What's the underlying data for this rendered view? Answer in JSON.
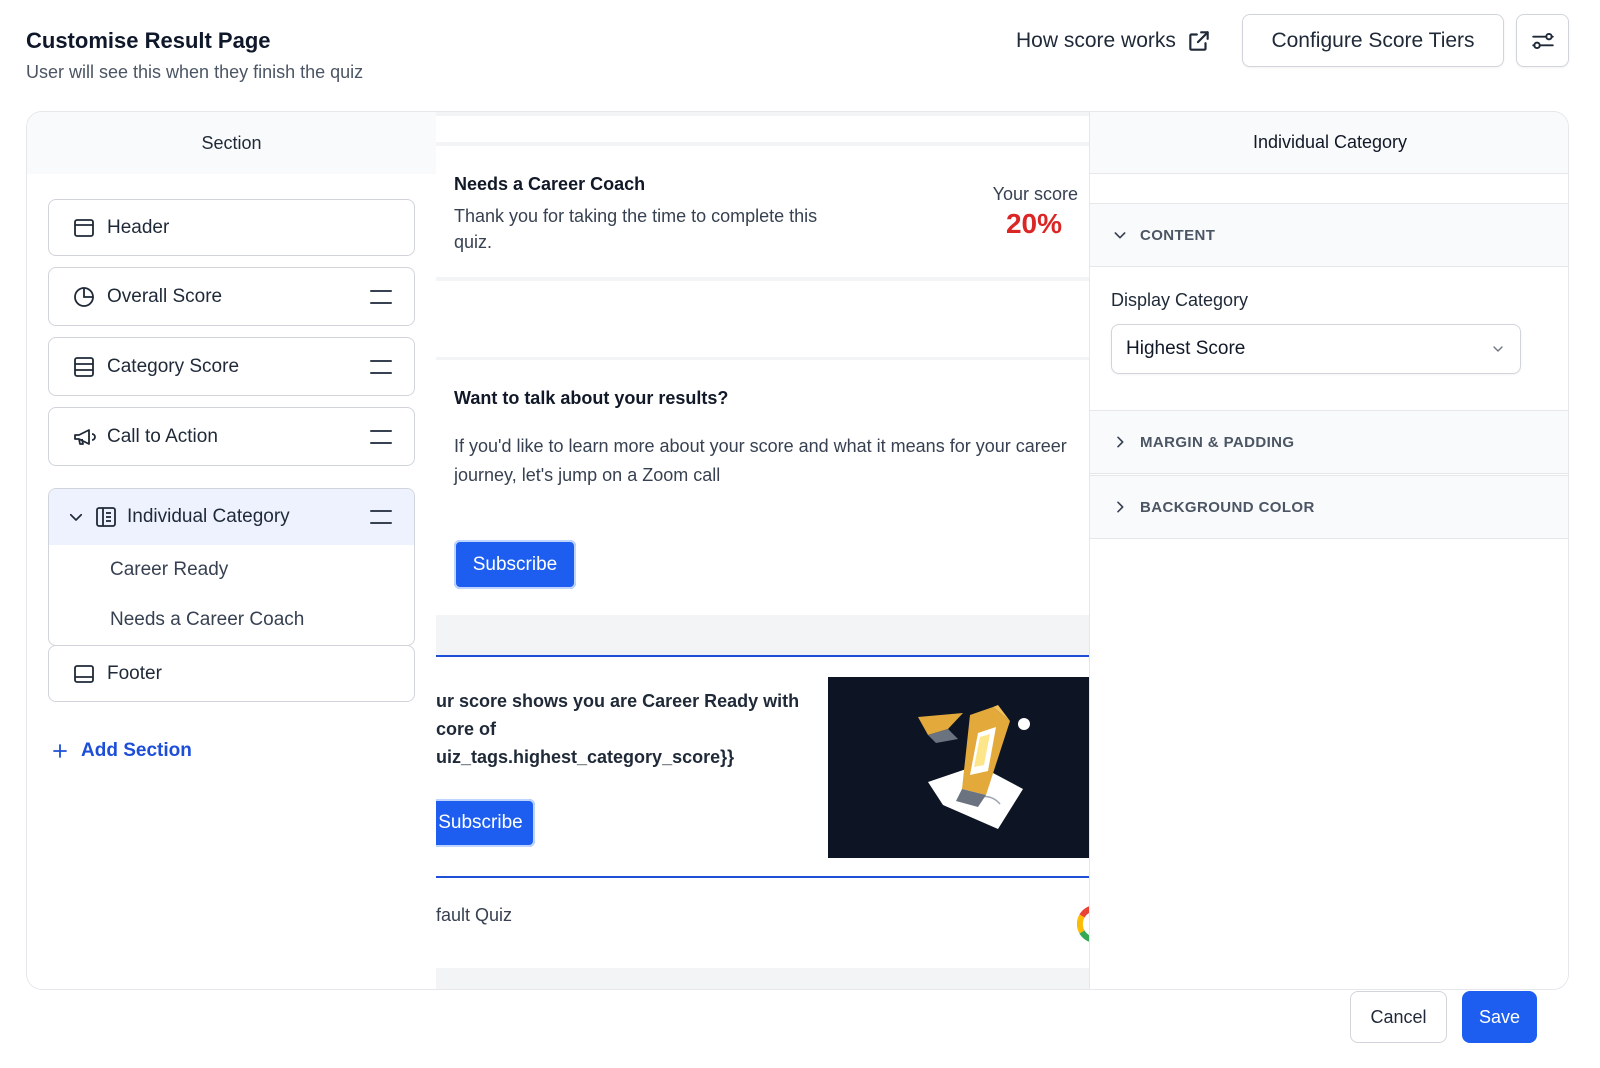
{
  "header": {
    "title": "Customise Result Page",
    "subtitle": "User will see this when they finish the quiz",
    "how_link": "How score works",
    "tiers_button": "Configure Score Tiers",
    "filter_icon": "sliders-icon"
  },
  "sections_panel": {
    "title": "Section",
    "items": [
      {
        "label": "Header",
        "icon": "layout-header-icon",
        "draggable": false
      },
      {
        "label": "Overall Score",
        "icon": "pie-chart-icon",
        "draggable": true
      },
      {
        "label": "Category Score",
        "icon": "rows-icon",
        "draggable": true
      },
      {
        "label": "Call to Action",
        "icon": "megaphone-icon",
        "draggable": true
      }
    ],
    "group": {
      "label": "Individual Category",
      "icon": "document-icon",
      "children": [
        "Career Ready",
        "Needs a Career Coach"
      ]
    },
    "footer_item": {
      "label": "Footer",
      "icon": "layout-footer-icon"
    },
    "add_section": "Add Section"
  },
  "preview": {
    "score_card": {
      "title": "Needs a Career Coach",
      "body": "Thank you for taking the time to complete this quiz.",
      "score_label": "Your score",
      "score_value": "20%"
    },
    "cta": {
      "title": "Want to talk about your results?",
      "body": "If you'd like to learn more about your score and what it means for your career journey, let's jump on a Zoom call",
      "button": "Subscribe"
    },
    "hero": {
      "line1": "ur score shows you are Career Ready with",
      "line2": "core of",
      "line3": "uiz_tags.highest_category_score}}",
      "button": "Subscribe"
    },
    "footer_text": "fault Quiz"
  },
  "settings_panel": {
    "title": "Individual Category",
    "content_section": "CONTENT",
    "display_category_label": "Display Category",
    "display_category_value": "Highest Score",
    "margin_section": "MARGIN & PADDING",
    "background_section": "BACKGROUND COLOR"
  },
  "footer_actions": {
    "cancel": "Cancel",
    "save": "Save"
  },
  "colors": {
    "primary": "#1d5ef0",
    "score": "#dc2626",
    "hero_image_bg": "#0d1424"
  }
}
